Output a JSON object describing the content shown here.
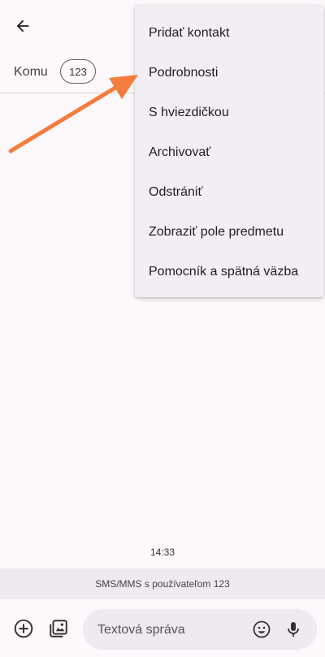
{
  "header": {
    "back_icon": "arrow-left-icon"
  },
  "to_row": {
    "label": "Komu",
    "recipient": "123"
  },
  "menu": {
    "items": [
      {
        "label": "Pridať kontakt"
      },
      {
        "label": "Podrobnosti"
      },
      {
        "label": "S hviezdičkou"
      },
      {
        "label": "Archivovať"
      },
      {
        "label": "Odstrániť"
      },
      {
        "label": "Zobraziť pole predmetu"
      },
      {
        "label": "Pomocník a spätná väzba"
      }
    ]
  },
  "annotation": {
    "arrow_color": "#f47c3c",
    "arrow_icon": "pointer-arrow-icon"
  },
  "conversation": {
    "timestamp": "14:33",
    "info": "SMS/MMS s používateľom 123"
  },
  "compose": {
    "placeholder": "Textová správa",
    "add_icon": "plus-circle-icon",
    "gallery_icon": "gallery-icon",
    "emoji_icon": "emoji-icon",
    "mic_icon": "mic-icon"
  }
}
